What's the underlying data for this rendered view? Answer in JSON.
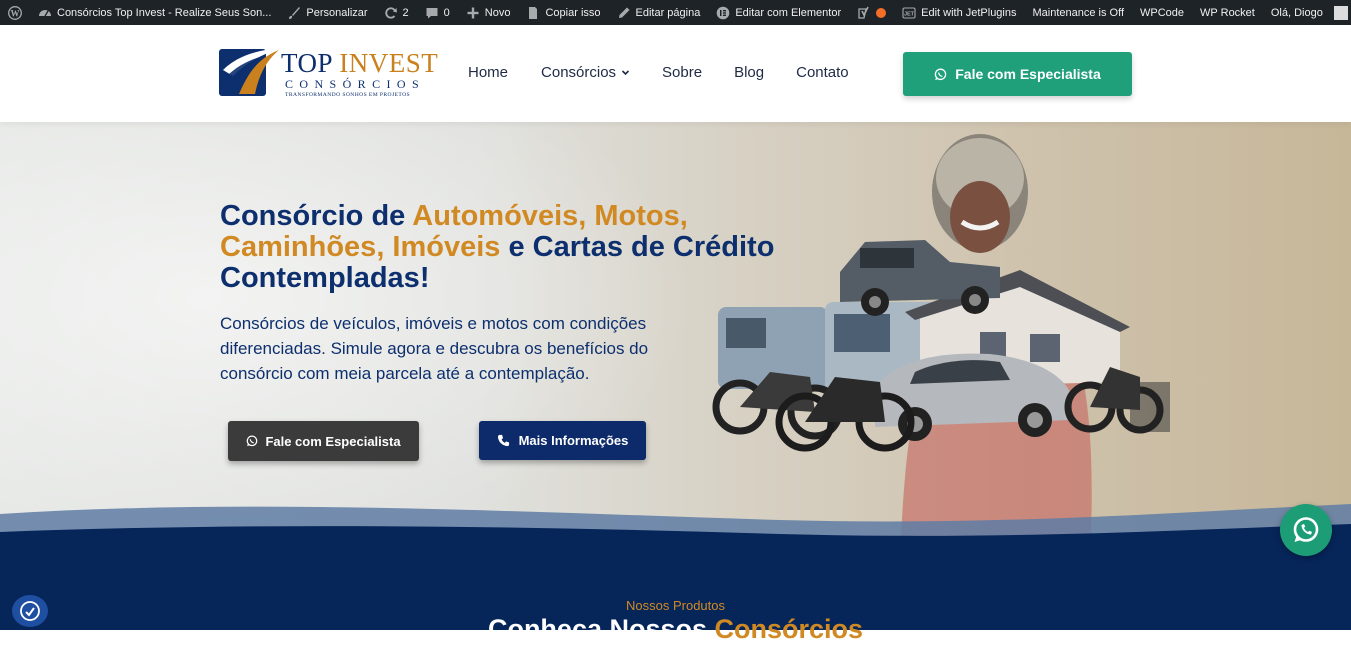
{
  "adminbar": {
    "site_title": "Consórcios Top Invest - Realize Seus Son...",
    "customize": "Personalizar",
    "updates_count": "2",
    "comments_count": "0",
    "new": "Novo",
    "copy": "Copiar isso",
    "edit_page": "Editar página",
    "edit_elementor": "Editar com Elementor",
    "jetplugins": "Edit with JetPlugins",
    "maintenance": "Maintenance is Off",
    "wpcode": "WPCode",
    "wprocket": "WP Rocket",
    "greeting": "Olá, Diogo"
  },
  "header": {
    "logo": {
      "word_top": "TOP",
      "word_invest": "INVEST",
      "word_sub": "CONSÓRCIOS",
      "tagline": "TRANSFORMANDO SONHOS EM PROJETOS"
    },
    "nav": [
      "Home",
      "Consórcios",
      "Sobre",
      "Blog",
      "Contato"
    ],
    "cta": "Fale com Especialista"
  },
  "hero": {
    "title_a": "Consórcio de ",
    "title_hl": "Automóveis, Motos, Caminhões, Imóveis",
    "title_b": " e Cartas de Crédito Contempladas!",
    "description": "Consórcios de veículos, imóveis e motos com condições diferenciadas. Simule agora e descubra os benefícios do consórcio com meia parcela até a contemplação.",
    "btn_primary": "Fale com Especialista",
    "btn_secondary": "Mais Informações"
  },
  "products": {
    "kicker": "Nossos Produtos",
    "title_a": "Conheça Nossos ",
    "title_hl": "Consórcios"
  },
  "colors": {
    "navy": "#0d2f6e",
    "gold": "#d18a23",
    "green": "#1fa07b",
    "dark_section": "#062559"
  },
  "icons": [
    "wordpress-icon",
    "dashboard-icon",
    "brush-icon",
    "refresh-icon",
    "comment-icon",
    "plus-icon",
    "copy-icon",
    "pencil-icon",
    "elementor-icon",
    "yoast-icon",
    "jet-icon",
    "whatsapp-icon",
    "phone-icon",
    "chevron-down-icon",
    "accessibility-icon"
  ]
}
